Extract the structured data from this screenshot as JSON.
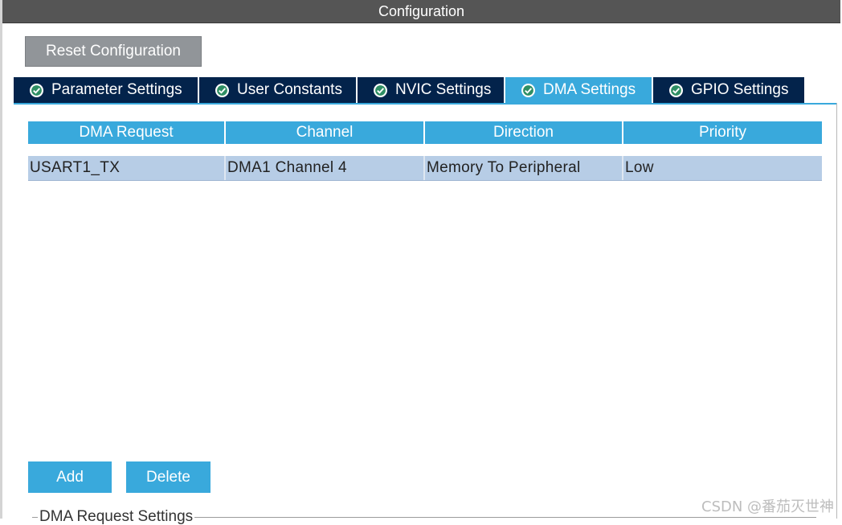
{
  "window": {
    "title": "Configuration"
  },
  "toolbar": {
    "reset_label": "Reset Configuration"
  },
  "tabs": [
    {
      "label": "Parameter Settings",
      "icon": "check-circle-icon",
      "active": false
    },
    {
      "label": "User Constants",
      "icon": "check-circle-icon",
      "active": false
    },
    {
      "label": "NVIC Settings",
      "icon": "check-circle-icon",
      "active": false
    },
    {
      "label": "DMA Settings",
      "icon": "check-circle-icon",
      "active": true
    },
    {
      "label": "GPIO Settings",
      "icon": "check-circle-icon",
      "active": false
    }
  ],
  "table": {
    "headers": [
      "DMA Request",
      "Channel",
      "Direction",
      "Priority"
    ],
    "rows": [
      [
        "USART1_TX",
        "DMA1 Channel 4",
        "Memory To Peripheral",
        "Low"
      ]
    ]
  },
  "actions": {
    "add_label": "Add",
    "delete_label": "Delete"
  },
  "settings_group": {
    "label": "DMA Request Settings"
  },
  "watermark": "CSDN @番茄灭世神",
  "colors": {
    "title_bar": "#555555",
    "tab_dark": "#03234b",
    "accent": "#39a9dc",
    "row_selected": "#b7cde6",
    "reset_button": "#919599"
  }
}
